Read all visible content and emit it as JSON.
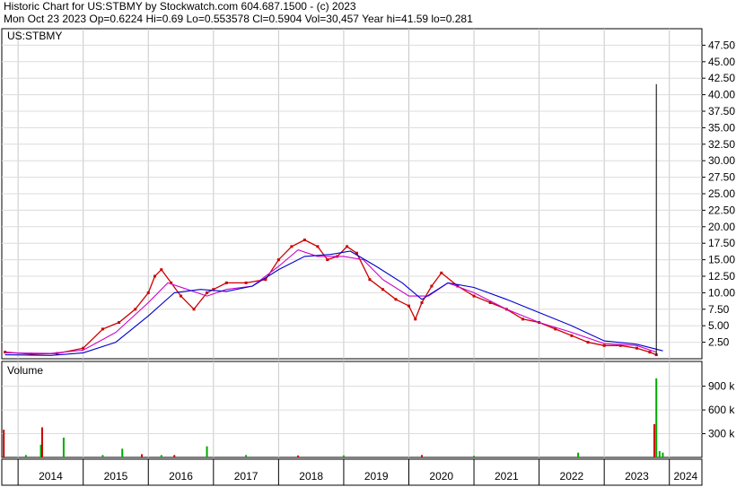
{
  "header": {
    "line1": "Historic Chart for US:STBMY by Stockwatch.com 604.687.1500 - (c) 2023",
    "line2": "Mon Oct 23 2023   Op=0.6224   Hi=0.69   Lo=0.553578   Cl=0.5904   Vol=30,457   Year hi=41.59   lo=0.281"
  },
  "chart_data": [
    {
      "type": "line",
      "title": "US:STBMY",
      "y_ticks": [
        "47.50",
        "45.00",
        "42.50",
        "40.00",
        "37.50",
        "35.00",
        "32.50",
        "30.00",
        "27.50",
        "25.00",
        "22.50",
        "20.00",
        "17.50",
        "15.00",
        "12.50",
        "10.00",
        "7.50",
        "5.00",
        "2.50"
      ],
      "ylim": [
        0,
        50
      ],
      "x_ticks": [
        "2014",
        "2015",
        "2016",
        "2017",
        "2018",
        "2019",
        "2020",
        "2021",
        "2022",
        "2023",
        "2024"
      ],
      "xlim": [
        2013.75,
        2024.5
      ],
      "grid": true,
      "spike": {
        "x": 2023.8,
        "high": 41.59
      },
      "series": [
        {
          "color": "#cc0000",
          "x": [
            2013.8,
            2014.2,
            2014.6,
            2015.0,
            2015.3,
            2015.55,
            2015.8,
            2016.0,
            2016.1,
            2016.2,
            2016.35,
            2016.5,
            2016.7,
            2016.9,
            2017.0,
            2017.2,
            2017.5,
            2017.8,
            2018.0,
            2018.2,
            2018.4,
            2018.6,
            2018.75,
            2018.9,
            2019.05,
            2019.2,
            2019.4,
            2019.6,
            2019.8,
            2020.0,
            2020.1,
            2020.2,
            2020.35,
            2020.5,
            2020.75,
            2021.0,
            2021.25,
            2021.5,
            2021.75,
            2022.0,
            2022.25,
            2022.5,
            2022.75,
            2023.0,
            2023.25,
            2023.5,
            2023.7,
            2023.8
          ],
          "y": [
            1.0,
            0.7,
            0.8,
            1.6,
            4.5,
            5.5,
            7.5,
            10.0,
            12.5,
            13.5,
            11.5,
            9.5,
            7.5,
            10.0,
            10.5,
            11.5,
            11.5,
            12.0,
            15.0,
            17.0,
            18.0,
            17.0,
            15.0,
            15.5,
            17.0,
            16.0,
            12.0,
            10.5,
            9.0,
            8.0,
            6.0,
            8.5,
            11.0,
            13.0,
            11.0,
            9.5,
            8.5,
            7.5,
            6.0,
            5.5,
            4.5,
            3.5,
            2.5,
            2.0,
            2.0,
            1.6,
            1.0,
            0.6
          ]
        },
        {
          "color": "#cc00cc",
          "x": [
            2013.8,
            2014.5,
            2015.0,
            2015.5,
            2016.0,
            2016.3,
            2016.6,
            2016.9,
            2017.2,
            2017.6,
            2018.0,
            2018.3,
            2018.6,
            2019.0,
            2019.3,
            2019.6,
            2020.0,
            2020.3,
            2020.6,
            2021.0,
            2021.5,
            2022.0,
            2022.5,
            2023.0,
            2023.5,
            2023.8
          ],
          "y": [
            0.9,
            0.8,
            1.3,
            4.0,
            8.5,
            11.5,
            10.5,
            9.5,
            10.5,
            11.0,
            14.0,
            16.5,
            15.5,
            15.5,
            15.0,
            12.0,
            9.5,
            9.5,
            11.5,
            10.0,
            7.5,
            5.5,
            4.0,
            2.3,
            2.0,
            1.0
          ]
        },
        {
          "color": "#0000cc",
          "x": [
            2013.8,
            2014.5,
            2015.0,
            2015.5,
            2016.0,
            2016.4,
            2016.8,
            2017.2,
            2017.6,
            2018.0,
            2018.4,
            2018.8,
            2019.1,
            2019.5,
            2019.9,
            2020.2,
            2020.6,
            2021.0,
            2021.5,
            2022.0,
            2022.5,
            2023.0,
            2023.5,
            2023.9
          ],
          "y": [
            0.6,
            0.5,
            0.9,
            2.5,
            6.5,
            10.0,
            10.5,
            10.2,
            11.0,
            13.5,
            15.5,
            15.8,
            16.3,
            14.0,
            11.5,
            9.0,
            11.5,
            10.8,
            9.0,
            7.0,
            5.0,
            2.7,
            2.2,
            1.2
          ]
        }
      ]
    },
    {
      "type": "bar",
      "title": "Volume",
      "y_ticks": [
        "900 k",
        "600 k",
        "300 k"
      ],
      "ylim": [
        0,
        1100000
      ],
      "bars": [
        {
          "x": 2013.78,
          "v": 350000,
          "color": "#cc0000"
        },
        {
          "x": 2014.12,
          "v": 30000,
          "color": "#00aa00"
        },
        {
          "x": 2014.35,
          "v": 160000,
          "color": "#00aa00"
        },
        {
          "x": 2014.37,
          "v": 380000,
          "color": "#cc0000"
        },
        {
          "x": 2014.7,
          "v": 250000,
          "color": "#00aa00"
        },
        {
          "x": 2015.3,
          "v": 30000,
          "color": "#00aa00"
        },
        {
          "x": 2015.6,
          "v": 110000,
          "color": "#00aa00"
        },
        {
          "x": 2015.9,
          "v": 40000,
          "color": "#cc0000"
        },
        {
          "x": 2016.2,
          "v": 30000,
          "color": "#00aa00"
        },
        {
          "x": 2016.4,
          "v": 30000,
          "color": "#cc0000"
        },
        {
          "x": 2016.9,
          "v": 140000,
          "color": "#00aa00"
        },
        {
          "x": 2017.5,
          "v": 30000,
          "color": "#00aa00"
        },
        {
          "x": 2018.3,
          "v": 25000,
          "color": "#cc0000"
        },
        {
          "x": 2019.0,
          "v": 25000,
          "color": "#00aa00"
        },
        {
          "x": 2020.2,
          "v": 30000,
          "color": "#cc0000"
        },
        {
          "x": 2021.0,
          "v": 20000,
          "color": "#00aa00"
        },
        {
          "x": 2022.6,
          "v": 60000,
          "color": "#00aa00"
        },
        {
          "x": 2023.77,
          "v": 420000,
          "color": "#cc0000"
        },
        {
          "x": 2023.8,
          "v": 1000000,
          "color": "#00aa00"
        },
        {
          "x": 2023.85,
          "v": 80000,
          "color": "#00aa00"
        },
        {
          "x": 2023.9,
          "v": 60000,
          "color": "#00aa00"
        }
      ]
    }
  ]
}
